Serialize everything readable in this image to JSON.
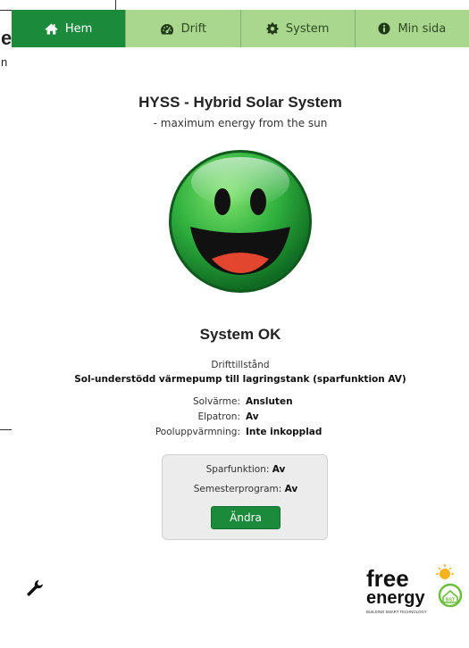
{
  "nav": {
    "tabs": [
      {
        "label": "Hem",
        "icon": "home-icon",
        "active": true
      },
      {
        "label": "Drift",
        "icon": "dashboard-icon",
        "active": false
      },
      {
        "label": "System",
        "icon": "gear-icon",
        "active": false
      },
      {
        "label": "Min sida",
        "icon": "info-icon",
        "active": false
      }
    ]
  },
  "background": {
    "fragment_1": "e",
    "fragment_2": "n"
  },
  "main": {
    "title": "HYSS - Hybrid Solar System",
    "subtitle": "- maximum energy from the sun",
    "status": "System OK",
    "mode_label": "Drifttillstånd",
    "mode_value": "Sol-understödd värmepump till lagringstank (sparfunktion AV)",
    "details": [
      {
        "key": "Solvärme:",
        "value": "Ansluten"
      },
      {
        "key": "Elpatron:",
        "value": "Av"
      },
      {
        "key": "Pooluppvärmning:",
        "value": "Inte inkopplad"
      }
    ]
  },
  "settings": {
    "saving_label": "Sparfunktion:",
    "saving_value": "Av",
    "vacation_label": "Semesterprogram:",
    "vacation_value": "Av",
    "change_button": "Ändra"
  },
  "logo": {
    "line1": "free",
    "line2": "energy",
    "badge": "BST",
    "tagline": "BUILDING SMART TECHNOLOGY"
  },
  "colors": {
    "primary": "#1c8a3b",
    "tab_inactive": "#a9d78e",
    "smiley": "#3bb94a"
  }
}
